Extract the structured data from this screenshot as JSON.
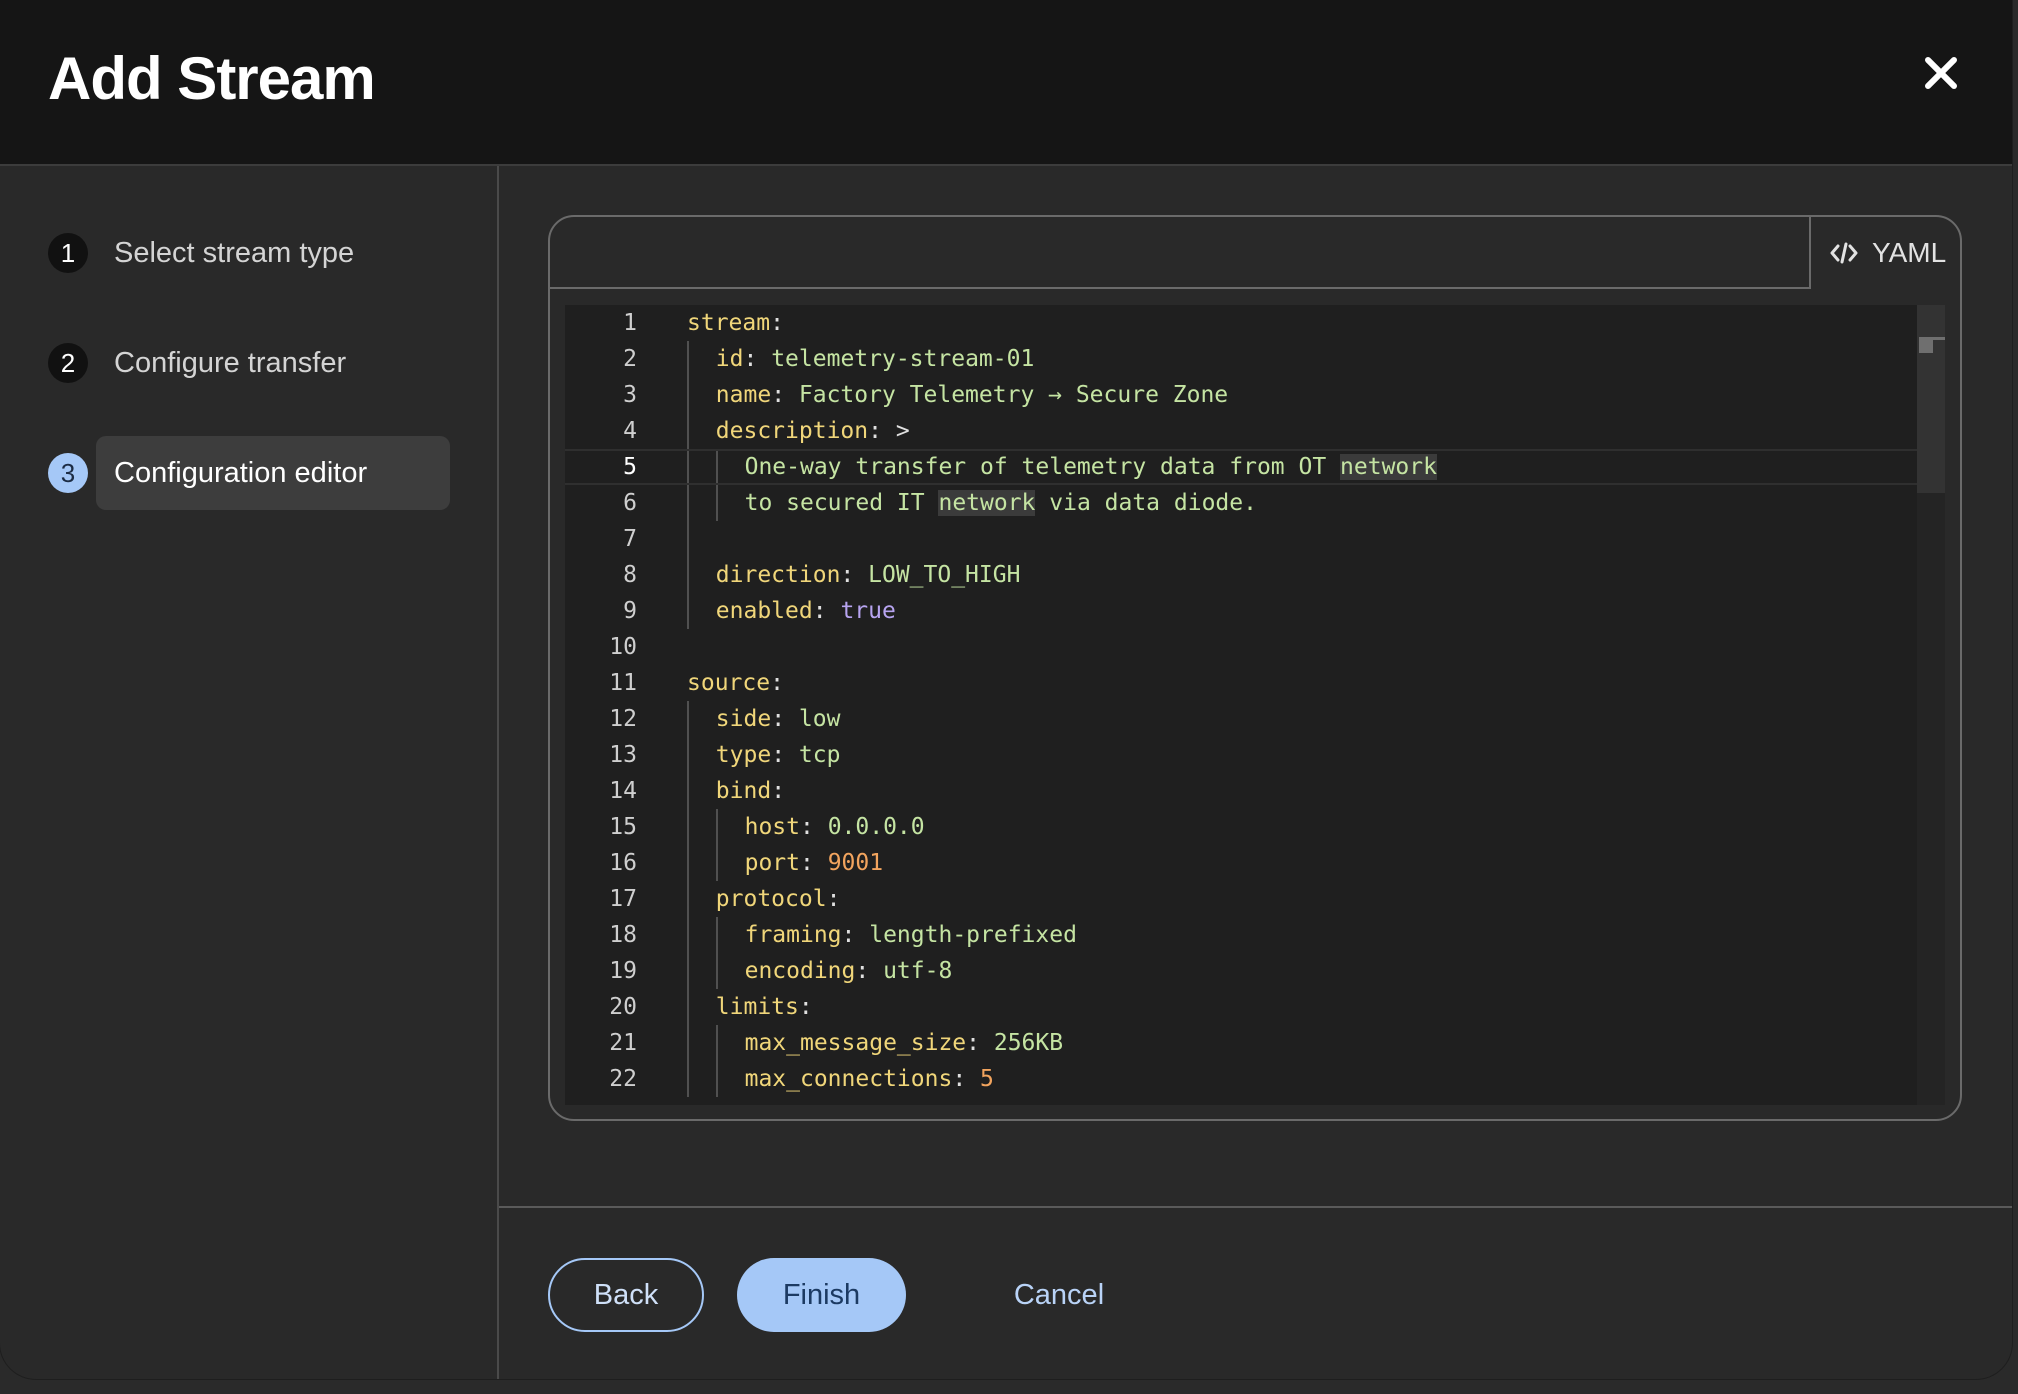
{
  "modal": {
    "title": "Add Stream",
    "close_icon": "close-icon"
  },
  "steps": [
    {
      "number": "1",
      "label": "Select stream type",
      "active": false
    },
    {
      "number": "2",
      "label": "Configure transfer",
      "active": false
    },
    {
      "number": "3",
      "label": "Configuration editor",
      "active": true
    }
  ],
  "editor": {
    "tab_label": "YAML",
    "tab_icon": "code-icon",
    "current_line": 5,
    "lines": [
      {
        "n": "1",
        "indent": 0,
        "parts": [
          {
            "t": "stream",
            "c": "k"
          },
          {
            "t": ":",
            "c": "p"
          }
        ]
      },
      {
        "n": "2",
        "indent": 1,
        "parts": [
          {
            "t": "id",
            "c": "k"
          },
          {
            "t": ": ",
            "c": "p"
          },
          {
            "t": "telemetry-stream-01",
            "c": "s"
          }
        ]
      },
      {
        "n": "3",
        "indent": 1,
        "parts": [
          {
            "t": "name",
            "c": "k"
          },
          {
            "t": ": ",
            "c": "p"
          },
          {
            "t": "Factory Telemetry → Secure Zone",
            "c": "s"
          }
        ]
      },
      {
        "n": "4",
        "indent": 1,
        "parts": [
          {
            "t": "description",
            "c": "k"
          },
          {
            "t": ": >",
            "c": "p"
          }
        ]
      },
      {
        "n": "5",
        "indent": 2,
        "parts": [
          {
            "t": "One-way transfer of telemetry data from OT ",
            "c": "s"
          },
          {
            "t": "network",
            "c": "s hl"
          }
        ]
      },
      {
        "n": "6",
        "indent": 2,
        "parts": [
          {
            "t": "to secured IT ",
            "c": "s"
          },
          {
            "t": "network",
            "c": "s hl"
          },
          {
            "t": " via data diode.",
            "c": "s"
          }
        ]
      },
      {
        "n": "7",
        "indent": 1,
        "parts": []
      },
      {
        "n": "8",
        "indent": 1,
        "parts": [
          {
            "t": "direction",
            "c": "k"
          },
          {
            "t": ": ",
            "c": "p"
          },
          {
            "t": "LOW_TO_HIGH",
            "c": "s"
          }
        ]
      },
      {
        "n": "9",
        "indent": 1,
        "parts": [
          {
            "t": "enabled",
            "c": "k"
          },
          {
            "t": ": ",
            "c": "p"
          },
          {
            "t": "true",
            "c": "b"
          }
        ]
      },
      {
        "n": "10",
        "indent": 0,
        "parts": []
      },
      {
        "n": "11",
        "indent": 0,
        "parts": [
          {
            "t": "source",
            "c": "k"
          },
          {
            "t": ":",
            "c": "p"
          }
        ]
      },
      {
        "n": "12",
        "indent": 1,
        "parts": [
          {
            "t": "side",
            "c": "k"
          },
          {
            "t": ": ",
            "c": "p"
          },
          {
            "t": "low",
            "c": "s"
          }
        ]
      },
      {
        "n": "13",
        "indent": 1,
        "parts": [
          {
            "t": "type",
            "c": "k"
          },
          {
            "t": ": ",
            "c": "p"
          },
          {
            "t": "tcp",
            "c": "s"
          }
        ]
      },
      {
        "n": "14",
        "indent": 1,
        "parts": [
          {
            "t": "bind",
            "c": "k"
          },
          {
            "t": ":",
            "c": "p"
          }
        ]
      },
      {
        "n": "15",
        "indent": 2,
        "parts": [
          {
            "t": "host",
            "c": "k"
          },
          {
            "t": ": ",
            "c": "p"
          },
          {
            "t": "0.0.0.0",
            "c": "s"
          }
        ]
      },
      {
        "n": "16",
        "indent": 2,
        "parts": [
          {
            "t": "port",
            "c": "k"
          },
          {
            "t": ": ",
            "c": "p"
          },
          {
            "t": "9001",
            "c": "n"
          }
        ]
      },
      {
        "n": "17",
        "indent": 1,
        "parts": [
          {
            "t": "protocol",
            "c": "k"
          },
          {
            "t": ":",
            "c": "p"
          }
        ]
      },
      {
        "n": "18",
        "indent": 2,
        "parts": [
          {
            "t": "framing",
            "c": "k"
          },
          {
            "t": ": ",
            "c": "p"
          },
          {
            "t": "length-prefixed",
            "c": "s"
          }
        ]
      },
      {
        "n": "19",
        "indent": 2,
        "parts": [
          {
            "t": "encoding",
            "c": "k"
          },
          {
            "t": ": ",
            "c": "p"
          },
          {
            "t": "utf-8",
            "c": "s"
          }
        ]
      },
      {
        "n": "20",
        "indent": 1,
        "parts": [
          {
            "t": "limits",
            "c": "k"
          },
          {
            "t": ":",
            "c": "p"
          }
        ]
      },
      {
        "n": "21",
        "indent": 2,
        "parts": [
          {
            "t": "max_message_size",
            "c": "k"
          },
          {
            "t": ": ",
            "c": "p"
          },
          {
            "t": "256KB",
            "c": "s"
          }
        ]
      },
      {
        "n": "22",
        "indent": 2,
        "parts": [
          {
            "t": "max_connections",
            "c": "k"
          },
          {
            "t": ": ",
            "c": "p"
          },
          {
            "t": "5",
            "c": "n"
          }
        ]
      }
    ]
  },
  "footer": {
    "back_label": "Back",
    "finish_label": "Finish",
    "cancel_label": "Cancel"
  },
  "colors": {
    "accent": "#a5c8f7",
    "header_bg": "#151515",
    "panel_bg": "#292929",
    "editor_bg": "#1f1f1f",
    "yaml_key": "#f0d67a",
    "yaml_string": "#c5e4a3",
    "yaml_bool": "#b7a4f0",
    "yaml_number": "#f2a45e"
  }
}
